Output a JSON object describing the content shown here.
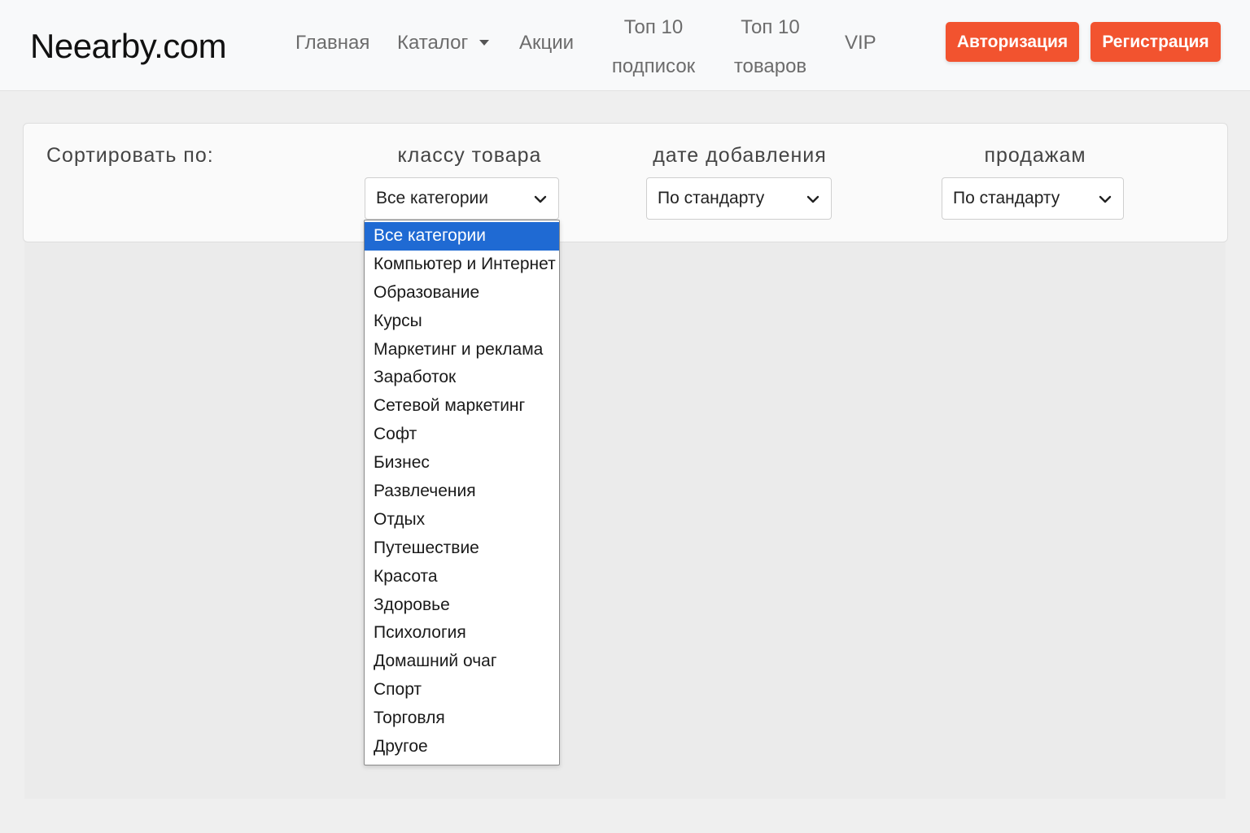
{
  "navbar": {
    "brand": "Neearby.com",
    "links": {
      "home": "Главная",
      "catalog": "Каталог",
      "sales": "Акции",
      "top_subs_line1": "Топ 10",
      "top_subs_line2": "подписок",
      "top_goods_line1": "Топ 10",
      "top_goods_line2": "товаров",
      "vip": "VIP"
    },
    "buttons": {
      "login": "Авторизация",
      "register": "Регистрация"
    },
    "accent_color": "#f2532f"
  },
  "sort": {
    "label": "Сортировать по:",
    "class_label": "классу товара",
    "date_label": "дате добавления",
    "sales_label": "продажам",
    "class_value": "Все категории",
    "date_value": "По стандарту",
    "sales_value": "По стандарту"
  },
  "dropdown": {
    "selected_color": "#1f6ad3",
    "options": [
      "Все категории",
      "Компьютер и Интернет",
      "Образование",
      "Курсы",
      "Маркетинг и реклама",
      "Заработок",
      "Сетевой маркетинг",
      "Софт",
      "Бизнес",
      "Развлечения",
      "Отдых",
      "Путешествие",
      "Красота",
      "Здоровье",
      "Психология",
      "Домашний очаг",
      "Спорт",
      "Торговля",
      "Другое"
    ]
  }
}
